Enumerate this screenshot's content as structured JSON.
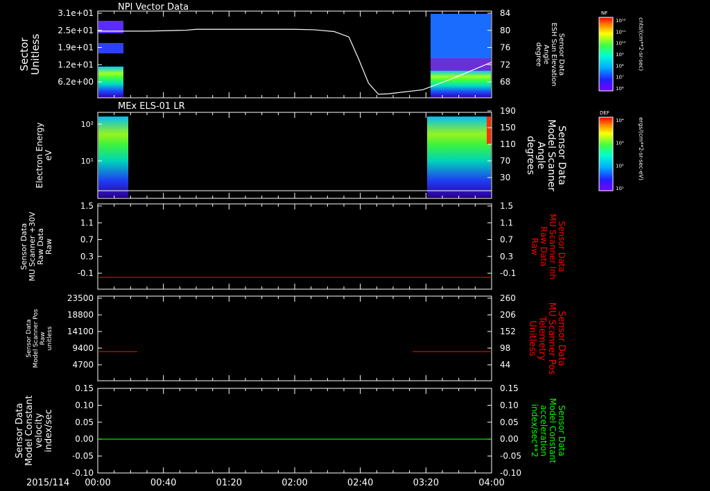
{
  "date_label": "2015/114",
  "time_ticks": [
    "00:00",
    "00:40",
    "01:20",
    "02:00",
    "02:40",
    "03:20",
    "04:00"
  ],
  "colors": {
    "white": "#ffffff",
    "red": "#ff0000",
    "green": "#00ff00",
    "background": "#000000"
  },
  "panels": [
    {
      "title": "NPI Vector Data",
      "left_label": [
        "Sector",
        "Unitless"
      ],
      "left_ticks": [
        "3.1e+01",
        "2.5e+01",
        "1.9e+01",
        "1.2e+01",
        "6.2e+00"
      ],
      "right_ticks": [
        "84",
        "80",
        "76",
        "72",
        "68"
      ],
      "right_label": [
        "Sensor Data",
        "ESH Sun Elevation",
        "Angle",
        "degree"
      ],
      "right_label_color": "#ffffff",
      "colorbar_title": "NF",
      "colorbar_unit": "cnts/(cm**2-sr-sec)",
      "colorbar_ticks": [
        "10¹²",
        "10¹¹",
        "10¹⁰",
        "10⁹",
        "10⁸",
        "10⁷",
        "10⁶"
      ]
    },
    {
      "title": "MEx ELS-01 LR",
      "left_label": [
        "Electron Energy",
        "eV"
      ],
      "left_ticks": [
        "10²",
        "10¹"
      ],
      "right_ticks": [
        "190",
        "150",
        "110",
        "70",
        "30"
      ],
      "right_label": [
        "Sensor Data",
        "Model Scanner",
        "Angle",
        "degrees"
      ],
      "right_label_color": "#ffffff",
      "colorbar_title": "DEF",
      "colorbar_unit": "ergs/(cm**2-sr-sec-eV)",
      "colorbar_ticks": [
        "10⁴",
        "10³",
        "10²",
        "10¹"
      ]
    },
    {
      "left_label": [
        "Sensor Data",
        "MU Scanner +30V",
        "Raw Data",
        "Raw"
      ],
      "left_ticks": [
        "1.5",
        "1.1",
        "0.7",
        "0.3",
        "-0.1"
      ],
      "right_ticks": [
        "1.5",
        "1.1",
        "0.7",
        "0.3",
        "-0.1"
      ],
      "right_label": [
        "Sensor Data",
        "MU Scanner Inh",
        "Raw Data",
        "Raw"
      ],
      "right_label_color": "#ff0000"
    },
    {
      "left_label": [
        "Sensor Data",
        "Model Scanner Pos",
        "Raw",
        "unitless"
      ],
      "left_ticks": [
        "23500",
        "18800",
        "14100",
        "9400",
        "4700"
      ],
      "right_ticks": [
        "260",
        "206",
        "152",
        "98",
        "44"
      ],
      "right_label": [
        "Sensor Data",
        "MU Scanner Pos",
        "Telemetry",
        "Unitless"
      ],
      "right_label_color": "#ff0000"
    },
    {
      "left_label": [
        "Sensor Data",
        "Model Constant",
        "velocity",
        "index/sec"
      ],
      "left_ticks": [
        "0.15",
        "0.10",
        "0.05",
        "0.00",
        "-0.05",
        "-0.10"
      ],
      "right_ticks": [
        "0.15",
        "0.10",
        "0.05",
        "0.00",
        "-0.05",
        "-0.10"
      ],
      "right_label": [
        "Sensor Data",
        "Model Constant",
        "acceleration",
        "index/sec**2"
      ],
      "right_label_color": "#00ff00"
    }
  ],
  "chart_data": [
    {
      "type": "line",
      "panel": 0,
      "series_note": "Sun elevation angle (right axis, degrees) vs time in hours",
      "x": [
        0.0,
        0.5,
        0.9,
        1.0,
        1.7,
        2.0,
        2.2,
        2.4,
        2.55,
        2.65,
        2.75,
        2.85,
        2.95,
        3.3,
        3.6,
        4.0
      ],
      "y": [
        79.5,
        79.5,
        79.7,
        79.9,
        79.9,
        79.9,
        79.8,
        79.4,
        78.2,
        73.2,
        67.8,
        65.3,
        65.4,
        66.3,
        68.8,
        72.5
      ],
      "ylim": [
        64.5,
        84
      ],
      "heatmap_blocks_hours": [
        [
          0.0,
          0.25
        ],
        [
          3.25,
          4.0
        ]
      ]
    },
    {
      "type": "heatmap",
      "panel": 1,
      "blocks_hours": [
        [
          0.0,
          0.3
        ],
        [
          3.25,
          4.0
        ]
      ],
      "energy_range_eV": [
        1,
        200
      ]
    },
    {
      "type": "line",
      "panel": 2,
      "x": [
        0.0,
        4.0
      ],
      "y": [
        -0.05,
        -0.05
      ],
      "ylim": [
        -0.3,
        1.5
      ],
      "color": "#ff0000"
    },
    {
      "type": "line",
      "panel": 3,
      "segments": [
        {
          "x": [
            0.0,
            0.4
          ],
          "y": [
            8100,
            8100
          ]
        },
        {
          "x": [
            3.2,
            4.0
          ],
          "y": [
            8100,
            8100
          ]
        }
      ],
      "ylim": [
        0,
        23500
      ],
      "color": "#ff0000"
    },
    {
      "type": "line",
      "panel": 4,
      "x": [
        0.0,
        4.0
      ],
      "y": [
        0.0,
        0.0
      ],
      "ylim": [
        -0.1,
        0.15
      ],
      "color": "#00ff00"
    }
  ]
}
